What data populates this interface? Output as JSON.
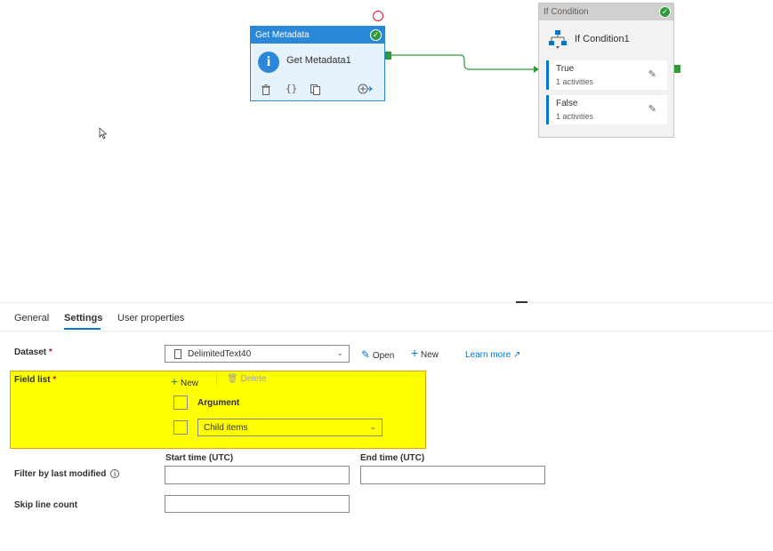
{
  "canvas": {
    "get_metadata": {
      "header": "Get Metadata",
      "name": "Get Metadata1",
      "status_icon": "checkmark-icon",
      "tools": [
        "delete-icon",
        "code-icon",
        "copy-icon",
        "add-output-icon"
      ]
    },
    "if_condition": {
      "header": "If Condition",
      "name": "If Condition1",
      "status_icon": "checkmark-icon",
      "branches": [
        {
          "label": "True",
          "sub": "1 activities"
        },
        {
          "label": "False",
          "sub": "1 activities"
        }
      ]
    },
    "colors": {
      "activity_blue": "#2b88d8",
      "success_green": "#2e9a3a",
      "error_red": "#e81123"
    }
  },
  "panel": {
    "tabs": [
      {
        "label": "General",
        "active": false
      },
      {
        "label": "Settings",
        "active": true
      },
      {
        "label": "User properties",
        "active": false
      }
    ],
    "dataset": {
      "label": "Dataset",
      "required_mark": "*",
      "value": "DelimitedText40",
      "open_label": "Open",
      "new_label": "New",
      "learn_more": "Learn more"
    },
    "field_list": {
      "label": "Field list",
      "required_mark": "*",
      "new_label": "New",
      "delete_label": "Delete",
      "items": [
        {
          "type": "text",
          "value": "Argument"
        },
        {
          "type": "select",
          "value": "Child items"
        }
      ],
      "highlight_color": "#ffff00"
    },
    "filter": {
      "label": "Filter by last modified",
      "start_label": "Start time (UTC)",
      "end_label": "End time (UTC)",
      "start_value": "",
      "end_value": ""
    },
    "skip": {
      "label": "Skip line count",
      "value": ""
    }
  }
}
